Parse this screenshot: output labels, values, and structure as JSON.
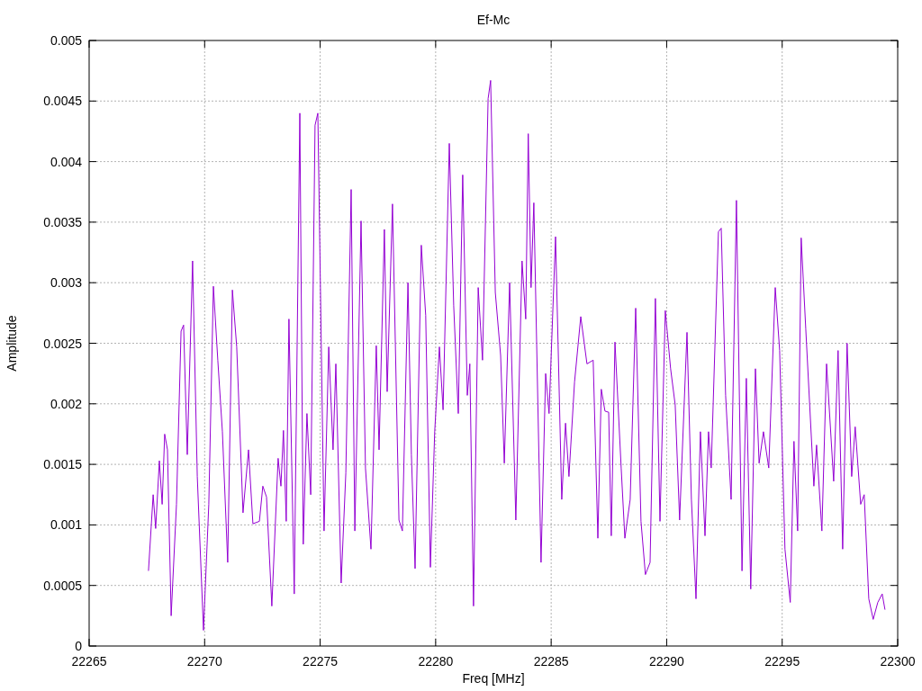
{
  "chart": {
    "chart_data": {
      "type": "line",
      "grid": true,
      "title": "Ef-Mc",
      "xlabel": "Freq [MHz]",
      "ylabel": "Amplitude",
      "xlim": [
        22265,
        22300
      ],
      "ylim": [
        0,
        0.005
      ],
      "xticks": [
        22265,
        22270,
        22275,
        22280,
        22285,
        22290,
        22295,
        22300
      ],
      "yticks": [
        0,
        0.0005,
        0.001,
        0.0015,
        0.002,
        0.0025,
        0.003,
        0.0035,
        0.004,
        0.0045,
        0.005
      ],
      "x": [
        22267.57,
        22267.77,
        22267.88,
        22268.04,
        22268.16,
        22268.27,
        22268.39,
        22268.55,
        22268.78,
        22268.98,
        22269.09,
        22269.25,
        22269.48,
        22269.68,
        22269.95,
        22270.18,
        22270.38,
        22270.57,
        22270.77,
        22271.0,
        22271.2,
        22271.39,
        22271.66,
        22271.9,
        22272.09,
        22272.37,
        22272.52,
        22272.68,
        22272.91,
        22273.18,
        22273.3,
        22273.41,
        22273.53,
        22273.65,
        22273.88,
        22274.12,
        22274.27,
        22274.43,
        22274.59,
        22274.78,
        22274.9,
        22275.17,
        22275.37,
        22275.56,
        22275.68,
        22275.91,
        22276.11,
        22276.34,
        22276.5,
        22276.77,
        22276.96,
        22277.2,
        22277.43,
        22277.55,
        22277.78,
        22277.9,
        22278.13,
        22278.41,
        22278.56,
        22278.8,
        22278.95,
        22279.11,
        22279.38,
        22279.57,
        22279.77,
        22279.96,
        22280.16,
        22280.32,
        22280.59,
        22280.78,
        22280.98,
        22281.17,
        22281.37,
        22281.48,
        22281.64,
        22281.84,
        22282.03,
        22282.27,
        22282.38,
        22282.58,
        22282.81,
        22282.97,
        22283.2,
        22283.47,
        22283.74,
        22283.9,
        22284.01,
        22284.13,
        22284.25,
        22284.56,
        22284.76,
        22284.91,
        22285.19,
        22285.46,
        22285.62,
        22285.77,
        22286.01,
        22286.28,
        22286.55,
        22286.82,
        22287.02,
        22287.17,
        22287.33,
        22287.49,
        22287.6,
        22287.76,
        22288.03,
        22288.19,
        22288.42,
        22288.66,
        22288.89,
        22289.08,
        22289.28,
        22289.51,
        22289.71,
        22289.94,
        22290.17,
        22290.37,
        22290.56,
        22290.88,
        22291.07,
        22291.27,
        22291.46,
        22291.66,
        22291.81,
        22291.93,
        22292.24,
        22292.36,
        22292.55,
        22292.79,
        22293.02,
        22293.26,
        22293.45,
        22293.64,
        22293.84,
        22294.0,
        22294.19,
        22294.42,
        22294.7,
        22294.89,
        22295.12,
        22295.35,
        22295.51,
        22295.67,
        22295.82,
        22296.02,
        22296.37,
        22296.49,
        22296.72,
        22296.92,
        22297.23,
        22297.42,
        22297.62,
        22297.81,
        22298.01,
        22298.16,
        22298.4,
        22298.55,
        22298.75,
        22298.94,
        22299.14,
        22299.33,
        22299.45
      ],
      "series": [
        {
          "color": "#9400d3",
          "values": [
            0.00062,
            0.00125,
            0.00097,
            0.00153,
            0.00117,
            0.00175,
            0.00162,
            0.00025,
            0.00117,
            0.0026,
            0.00265,
            0.00158,
            0.00318,
            0.0014,
            0.00013,
            0.00117,
            0.00297,
            0.00236,
            0.00177,
            0.00069,
            0.00294,
            0.00247,
            0.0011,
            0.00162,
            0.00101,
            0.00103,
            0.00132,
            0.00123,
            0.00033,
            0.00155,
            0.00132,
            0.00178,
            0.00103,
            0.0027,
            0.00043,
            0.0044,
            0.00084,
            0.00192,
            0.00125,
            0.0043,
            0.0044,
            0.00095,
            0.00247,
            0.00162,
            0.00233,
            0.00052,
            0.00143,
            0.00377,
            0.00095,
            0.00351,
            0.00147,
            0.0008,
            0.00248,
            0.00162,
            0.00344,
            0.0021,
            0.00365,
            0.00104,
            0.00095,
            0.003,
            0.00158,
            0.00064,
            0.00331,
            0.00273,
            0.00065,
            0.00177,
            0.00247,
            0.00195,
            0.00415,
            0.00281,
            0.00192,
            0.00389,
            0.00207,
            0.00233,
            0.00033,
            0.00296,
            0.00236,
            0.00452,
            0.00467,
            0.00292,
            0.0024,
            0.00151,
            0.003,
            0.00104,
            0.00318,
            0.0027,
            0.00423,
            0.00296,
            0.00366,
            0.00069,
            0.00225,
            0.00192,
            0.00338,
            0.00121,
            0.00184,
            0.0014,
            0.00218,
            0.00272,
            0.00233,
            0.00236,
            0.00089,
            0.00212,
            0.00194,
            0.00193,
            0.00091,
            0.00251,
            0.00147,
            0.00089,
            0.00121,
            0.00279,
            0.00103,
            0.00059,
            0.00069,
            0.00287,
            0.00103,
            0.00277,
            0.00229,
            0.00199,
            0.00104,
            0.00259,
            0.00121,
            0.00039,
            0.00177,
            0.00091,
            0.00177,
            0.00147,
            0.00342,
            0.00345,
            0.00207,
            0.00121,
            0.00368,
            0.00062,
            0.00221,
            0.00047,
            0.00229,
            0.00151,
            0.00177,
            0.00147,
            0.00296,
            0.00244,
            0.0008,
            0.00036,
            0.00169,
            0.00095,
            0.00337,
            0.00262,
            0.00132,
            0.00166,
            0.00095,
            0.00233,
            0.00136,
            0.00244,
            0.0008,
            0.0025,
            0.0014,
            0.00181,
            0.00117,
            0.00125,
            0.00039,
            0.00022,
            0.00036,
            0.00043,
            0.0003
          ]
        }
      ]
    }
  }
}
